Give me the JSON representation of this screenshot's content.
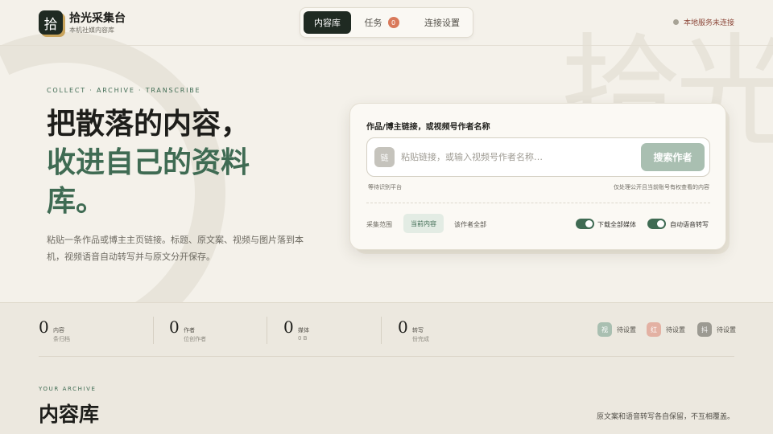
{
  "brand": {
    "logo_char": "拾",
    "name": "拾光采集台",
    "subtitle": "本机社媒内容库"
  },
  "nav": {
    "tabs": [
      {
        "label": "内容库",
        "active": true
      },
      {
        "label": "任务",
        "badge": "0"
      },
      {
        "label": "连接设置"
      }
    ]
  },
  "status": {
    "text": "本地服务未连接"
  },
  "background": {
    "watermark": "拾光"
  },
  "hero": {
    "eyebrow": "COLLECT · ARCHIVE · TRANSCRIBE",
    "title_line1": "把散落的内容，",
    "title_line2": "收进自己的资料",
    "title_line3": "库。",
    "description": "粘贴一条作品或博主主页链接。标题、原文案、视频与图片落到本机，视频语音自动转写并与原文分开保存。"
  },
  "card": {
    "label": "作品/博主链接，或视频号作者名称",
    "link_icon": "链",
    "input": {
      "value": "",
      "placeholder": "粘贴链接，或输入视频号作者名称…"
    },
    "search_button": "搜索作者",
    "hint_left": "等待识别平台",
    "hint_right": "仅处理公开且当前账号有权查看的内容",
    "scope": {
      "label": "采集范围",
      "current": "当前内容",
      "all": "该作者全部"
    },
    "toggles": {
      "media": {
        "label": "下载全部媒体",
        "on": true
      },
      "asr": {
        "label": "自动语音转写",
        "on": true
      }
    }
  },
  "stats": [
    {
      "value": "0",
      "label": "内容",
      "sub": "条归档"
    },
    {
      "value": "0",
      "label": "作者",
      "sub": "位创作者"
    },
    {
      "value": "0",
      "label": "媒体",
      "sub": "0 B"
    },
    {
      "value": "0",
      "label": "转写",
      "sub": "份完成"
    }
  ],
  "platforms": [
    {
      "icon": "视",
      "text": "待设置",
      "color": "#a9bfb1"
    },
    {
      "icon": "红",
      "text": "待设置",
      "color": "#e3b1a3"
    },
    {
      "icon": "抖",
      "text": "待设置",
      "color": "#9c9a92"
    }
  ],
  "archive": {
    "eyebrow": "YOUR ARCHIVE",
    "title": "内容库",
    "note": "原文案和语音转写各自保留，不互相覆盖。"
  }
}
